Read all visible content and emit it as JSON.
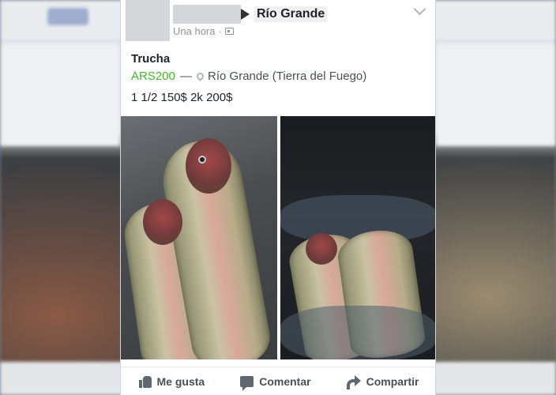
{
  "post": {
    "group_name": "Río Grande",
    "time": "Una hora",
    "title": "Trucha",
    "price": "ARS200",
    "separator": "—",
    "location": "Río Grande (Tierra del Fuego)",
    "description": "1 1/2 150$ 2k 200$"
  },
  "actions": {
    "like": "Me gusta",
    "comment": "Comentar",
    "share": "Compartir"
  },
  "colors": {
    "price": "#42b72a",
    "meta": "#90949c",
    "action_text": "#4b4f56"
  },
  "icons": [
    "play-arrow-icon",
    "photo-privacy-icon",
    "location-pin-icon",
    "chevron-down-icon",
    "like-icon",
    "comment-icon",
    "share-icon"
  ]
}
